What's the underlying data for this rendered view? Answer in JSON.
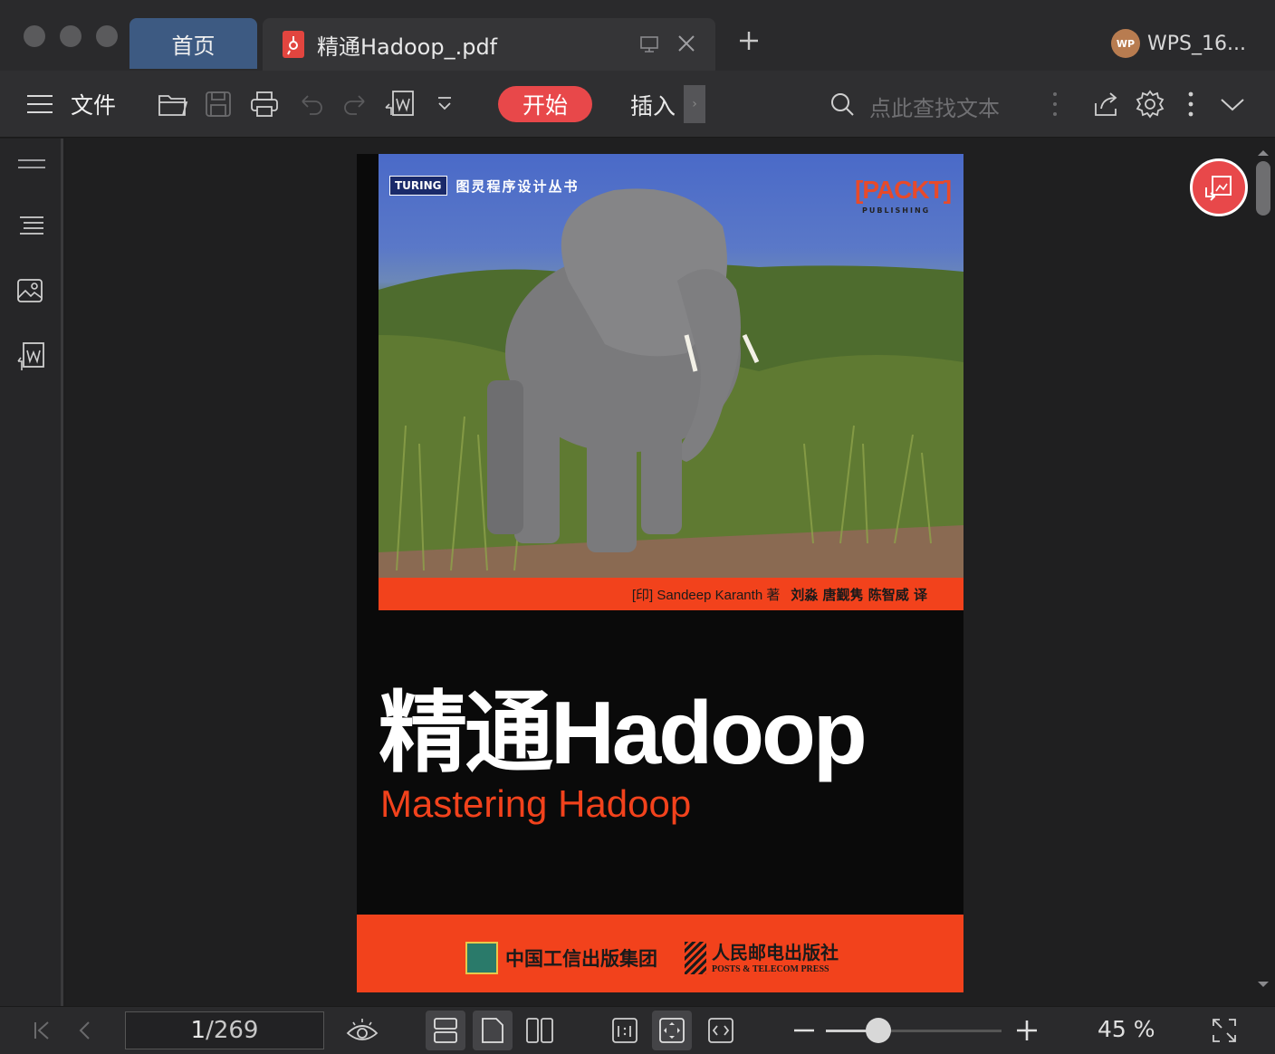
{
  "window": {
    "home_tab": "首页",
    "doc_tab": "精通Hadoop_.pdf",
    "user": "WPS_16...",
    "avatar": "WP"
  },
  "toolbar": {
    "file_label": "文件",
    "start_tab": "开始",
    "insert_tab": "插入",
    "search_placeholder": "点此查找文本",
    "accent": "#e8484a"
  },
  "cover": {
    "series_logo": "TURING",
    "series_name": "图灵程序设计丛书",
    "publisher_logo": "[PACKT]",
    "publisher_logo_sub": "PUBLISHING",
    "author_en": "[印] Sandeep Karanth 著",
    "translators": "刘淼 唐觐隽 陈智威 译",
    "title": "精通Hadoop",
    "subtitle": "Mastering Hadoop",
    "publisher1": "中国工信出版集团",
    "publisher2": "人民邮电出版社",
    "publisher2_en": "POSTS & TELECOM PRESS"
  },
  "status": {
    "current_page": "1",
    "total_pages": "/269",
    "zoom": "45 %",
    "zoom_value": 0.3
  }
}
